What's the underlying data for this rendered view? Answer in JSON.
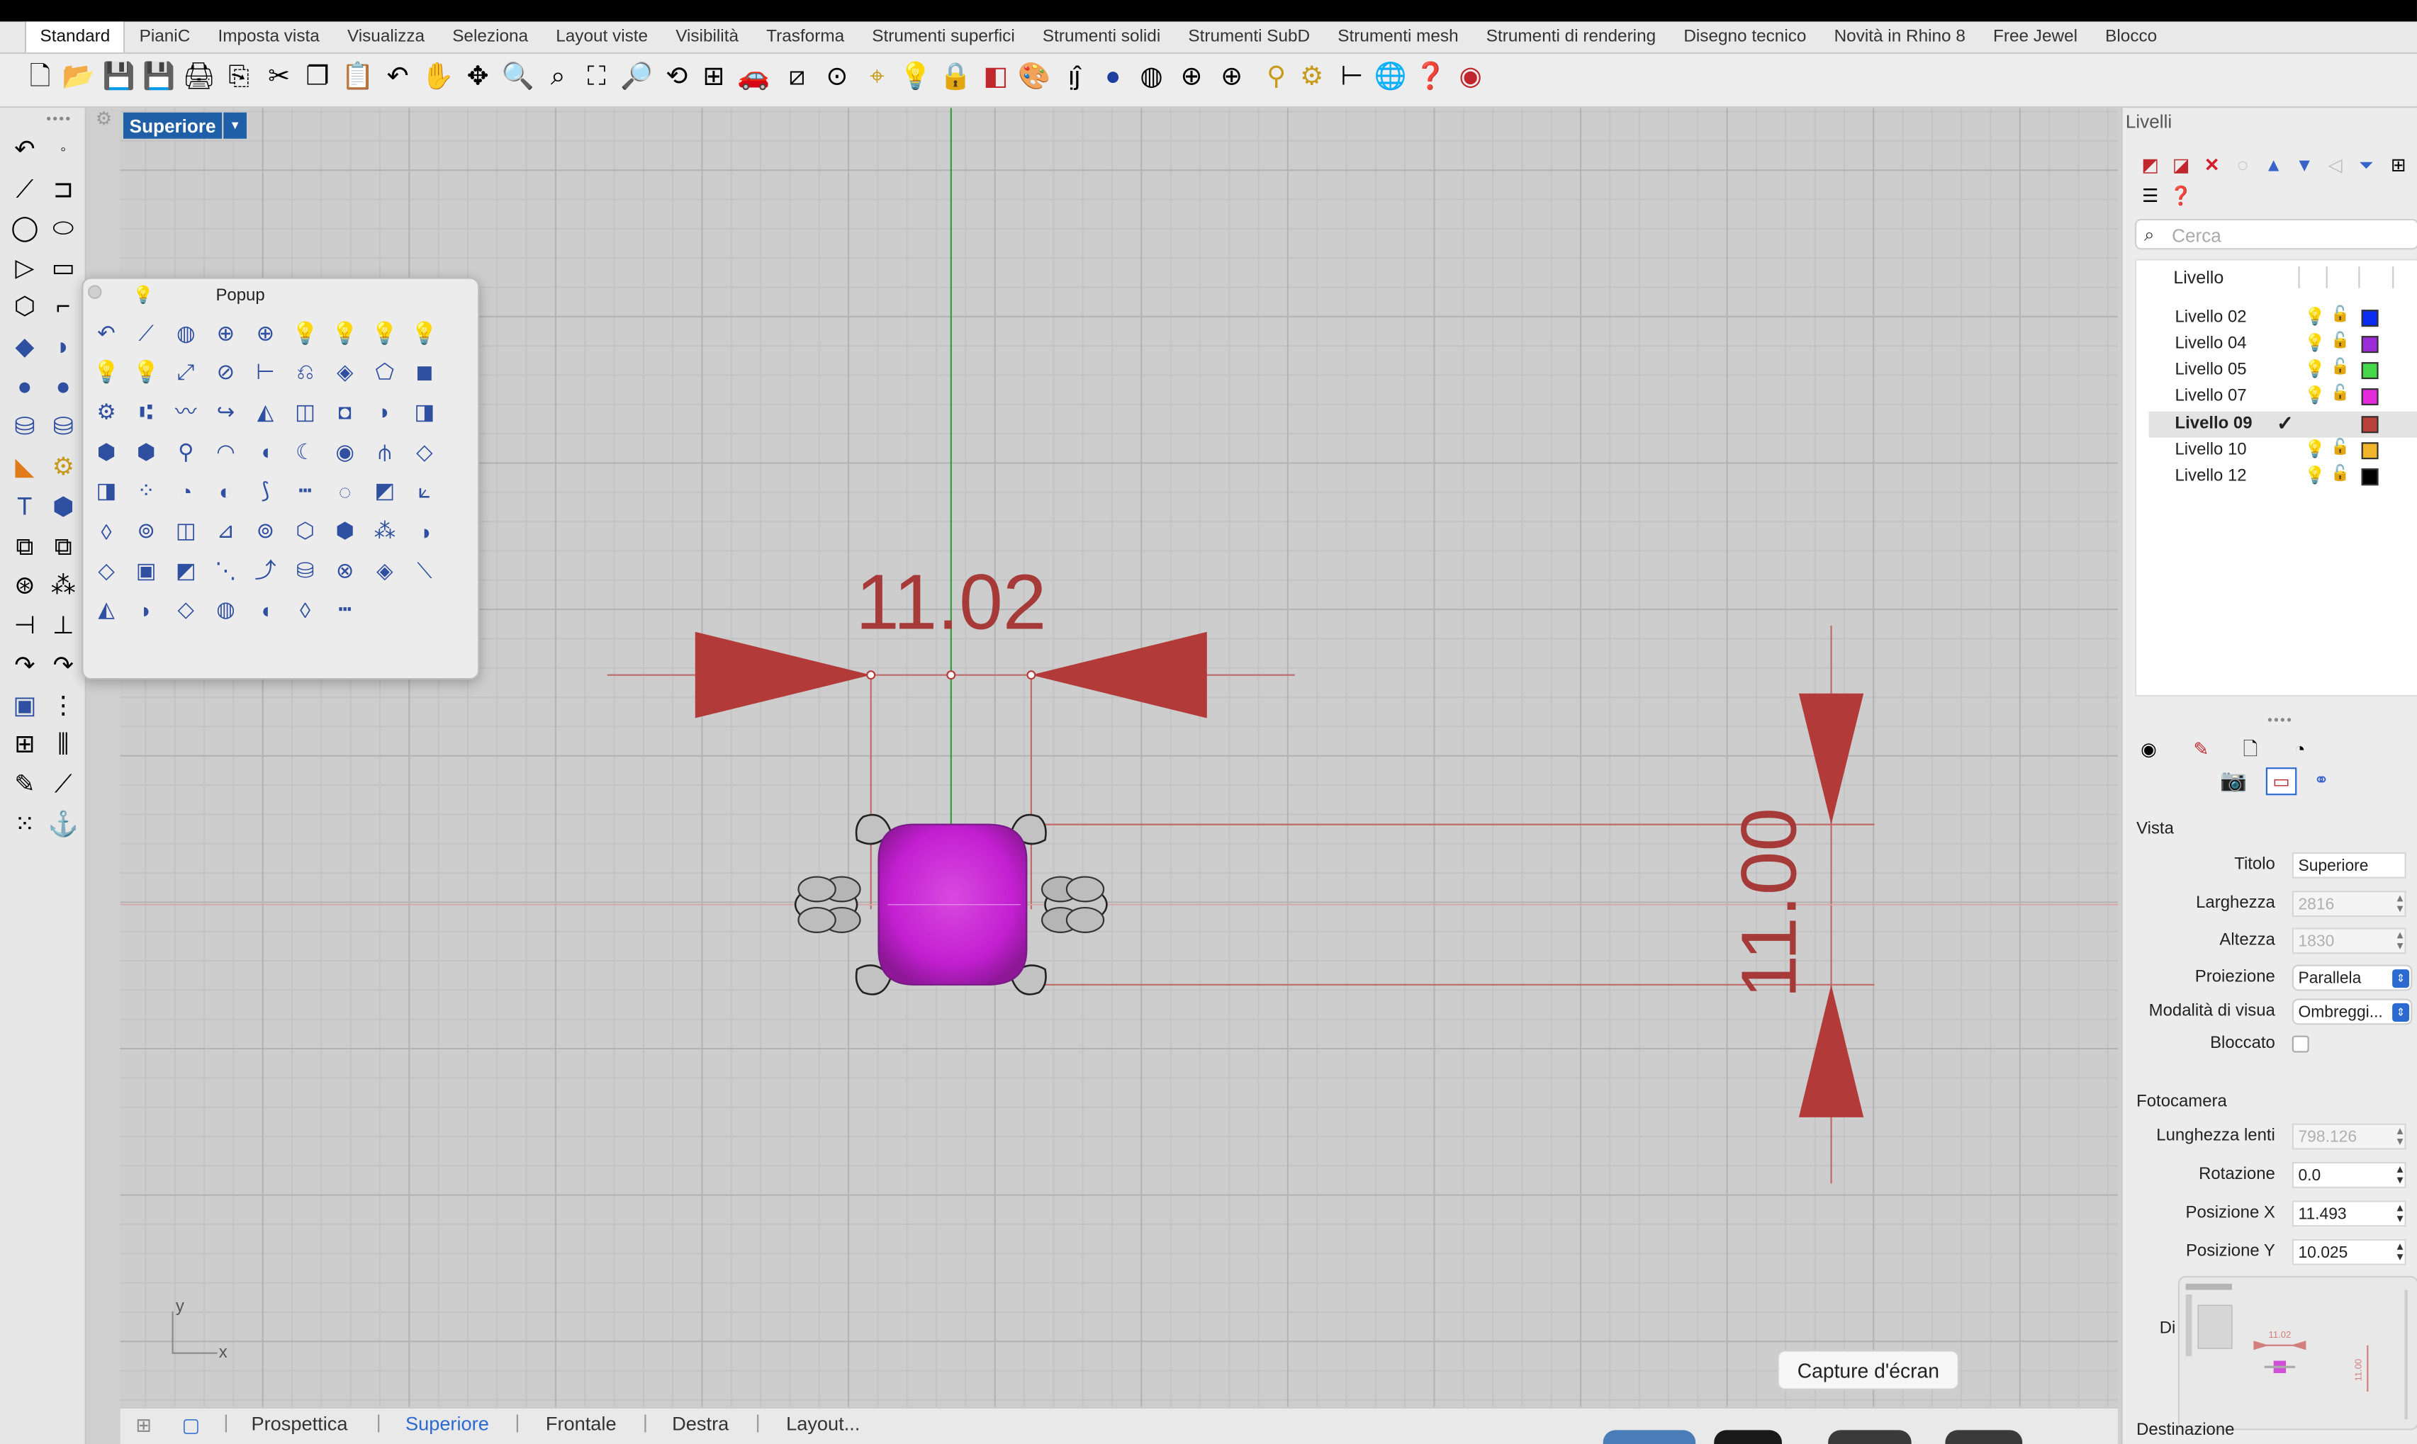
{
  "menu_tabs": [
    "Standard",
    "PianiC",
    "Imposta vista",
    "Visualizza",
    "Seleziona",
    "Layout viste",
    "Visibilità",
    "Trasforma",
    "Strumenti superfici",
    "Strumenti solidi",
    "Strumenti SubD",
    "Strumenti mesh",
    "Strumenti di rendering",
    "Disegno tecnico",
    "Novità in Rhino 8",
    "Free Jewel",
    "Blocco"
  ],
  "active_tab": "Standard",
  "viewport": {
    "label": "Superiore",
    "dim_horizontal": "11.02",
    "dim_vertical": "11.00",
    "axis_y": "y",
    "axis_x": "x"
  },
  "popup": {
    "title": "Popup"
  },
  "view_tabs": [
    "Prospettica",
    "Superiore",
    "Frontale",
    "Destra",
    "Layout..."
  ],
  "active_view_tab": "Superiore",
  "tooltip": "Capture d'écran",
  "layers_panel": {
    "title": "Livelli",
    "search_placeholder": "Cerca",
    "column_header": "Livello",
    "rows": [
      {
        "name": "Livello 02",
        "color": "#0a2cf0",
        "current": false
      },
      {
        "name": "Livello 04",
        "color": "#9b2cd8",
        "current": false
      },
      {
        "name": "Livello 05",
        "color": "#46d64a",
        "current": false
      },
      {
        "name": "Livello 07",
        "color": "#e32bd9",
        "current": false
      },
      {
        "name": "Livello 09",
        "color": "#b8413c",
        "current": true
      },
      {
        "name": "Livello 10",
        "color": "#f0b52c",
        "current": false
      },
      {
        "name": "Livello 12",
        "color": "#000000",
        "current": false
      }
    ]
  },
  "properties": {
    "vista_section": "Vista",
    "fotocamera_section": "Fotocamera",
    "titolo_label": "Titolo",
    "titolo_value": "Superiore",
    "larghezza_label": "Larghezza",
    "larghezza_value": "2816",
    "altezza_label": "Altezza",
    "altezza_value": "1830",
    "proiezione_label": "Proiezione",
    "proiezione_value": "Parallela",
    "modalita_label": "Modalità di visua",
    "modalita_value": "Ombreggi...",
    "bloccato_label": "Bloccato",
    "lente_label": "Lunghezza lenti",
    "lente_value": "798.126",
    "rotazione_label": "Rotazione",
    "rotazione_value": "0.0",
    "posx_label": "Posizione X",
    "posx_value": "11.493",
    "posy_label": "Posizione Y",
    "posy_value": "10.025",
    "dis_label": "Di",
    "destinazione_label": "Destinazione"
  },
  "thumbnail": {
    "dim_h": "11.02",
    "dim_v": "11.00"
  },
  "colors": {
    "dimension": "#a63a38",
    "gem": "#c21fd0",
    "accent_blue": "#2a6ad1",
    "viewport_bg": "#cdcdcd"
  }
}
